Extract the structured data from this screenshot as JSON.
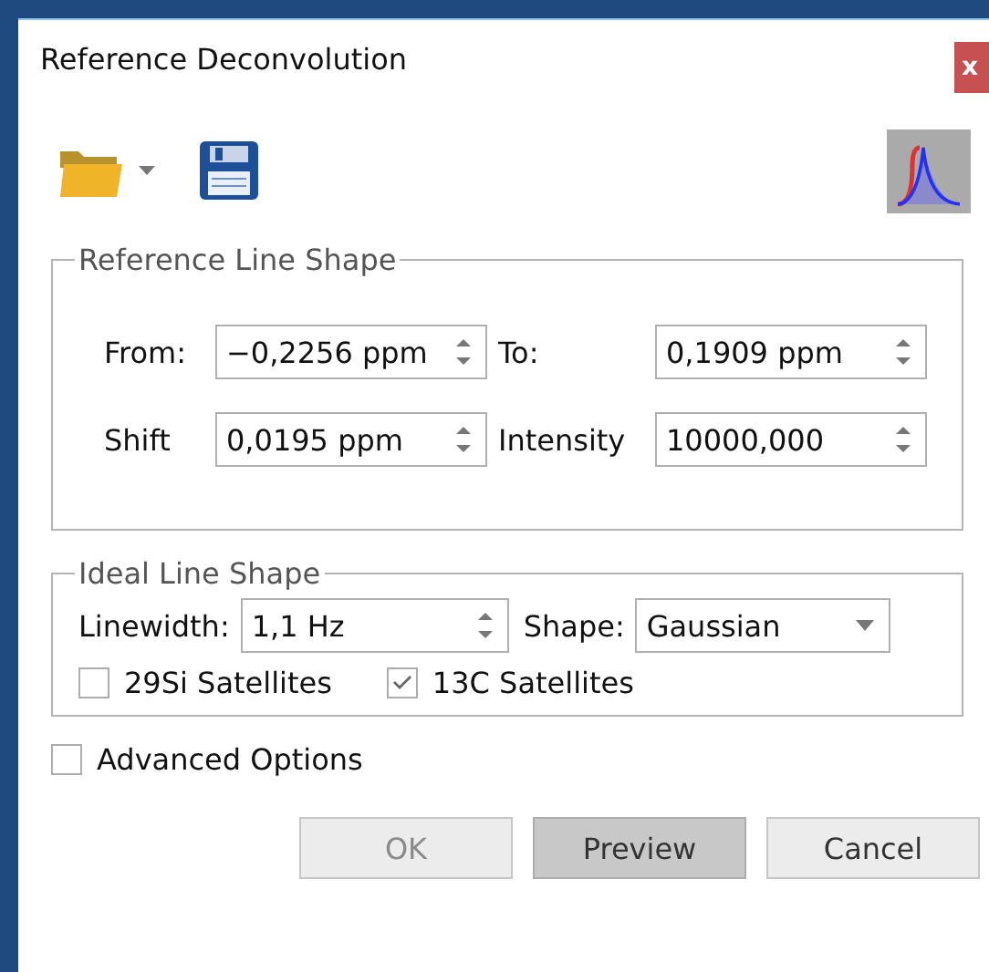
{
  "window": {
    "title": "Reference Deconvolution",
    "close": "x"
  },
  "reference_line_shape": {
    "title": "Reference Line Shape",
    "fields": [
      {
        "label": "From:",
        "value": "−0,2256 ppm",
        "kind": "spin"
      },
      {
        "label": "To:",
        "value": "0,1909 ppm",
        "kind": "spin"
      },
      {
        "label": "Shift",
        "value": "0,0195 ppm",
        "kind": "spin"
      },
      {
        "label": "Intensity",
        "value": "10000,000",
        "kind": "spin"
      }
    ]
  },
  "ideal_line_shape": {
    "title": "Ideal Line Shape",
    "fields": [
      {
        "label": "Linewidth:",
        "value": "1,1 Hz",
        "kind": "spin"
      },
      {
        "label": "Shape:",
        "value": "Gaussian",
        "kind": "combo"
      }
    ],
    "checkboxes": [
      {
        "label": "29Si Satellites",
        "checked": false
      },
      {
        "label": "13C Satellites",
        "checked": true
      }
    ]
  },
  "advanced_options": {
    "label": "Advanced Options",
    "checked": false
  },
  "buttons": [
    {
      "label": "OK",
      "disabled": true,
      "pressed": false
    },
    {
      "label": "Preview",
      "disabled": false,
      "pressed": true
    },
    {
      "label": "Cancel",
      "disabled": false,
      "pressed": false
    }
  ]
}
